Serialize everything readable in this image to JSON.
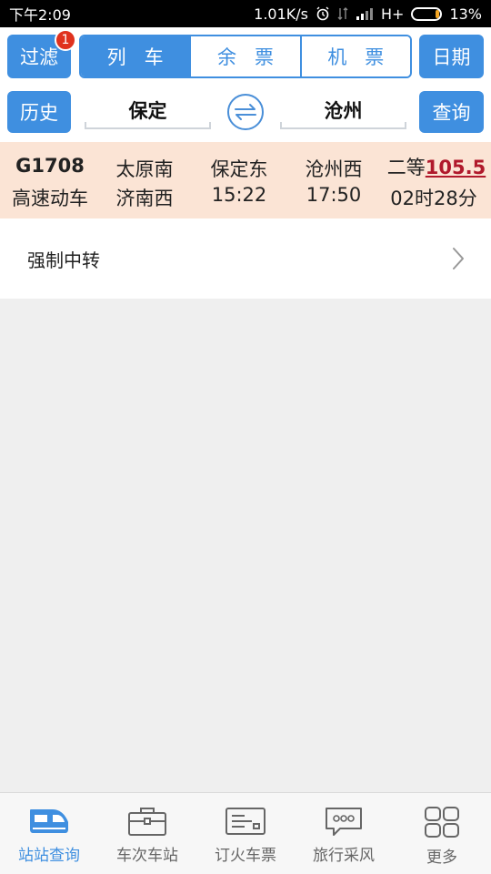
{
  "status_bar": {
    "time": "下午2:09",
    "network_speed": "1.01K/s",
    "network_type": "H+",
    "battery": "13%",
    "battery_level": 0.13
  },
  "toolbar": {
    "filter_label": "过滤",
    "filter_badge": "1",
    "segments": [
      {
        "label": "列车",
        "active": true
      },
      {
        "label": "余票",
        "active": false
      },
      {
        "label": "机票",
        "active": false
      }
    ],
    "date_label": "日期",
    "history_label": "历史",
    "query_label": "查询",
    "from_station": "保定",
    "to_station": "沧州"
  },
  "result": {
    "train_no": "G1708",
    "train_type": "高速动车",
    "origin": "太原南",
    "terminal": "济南西",
    "depart_station": "保定东",
    "depart_time": "15:22",
    "arrive_station": "沧州西",
    "arrive_time": "17:50",
    "seat_class": "二等",
    "price": "105.5",
    "duration": "02时28分"
  },
  "transfer": {
    "label": "强制中转"
  },
  "bottom_nav": [
    {
      "label": "站站查询",
      "icon": "train-icon",
      "active": true
    },
    {
      "label": "车次车站",
      "icon": "briefcase-icon",
      "active": false
    },
    {
      "label": "订火车票",
      "icon": "ticket-icon",
      "active": false
    },
    {
      "label": "旅行采风",
      "icon": "chat-bubble-icon",
      "active": false
    },
    {
      "label": "更多",
      "icon": "grid-icon",
      "active": false
    }
  ],
  "colors": {
    "accent": "#3f8fe0",
    "result_bg": "#fbe4d5",
    "price": "#b0192c",
    "badge": "#e0321e"
  }
}
